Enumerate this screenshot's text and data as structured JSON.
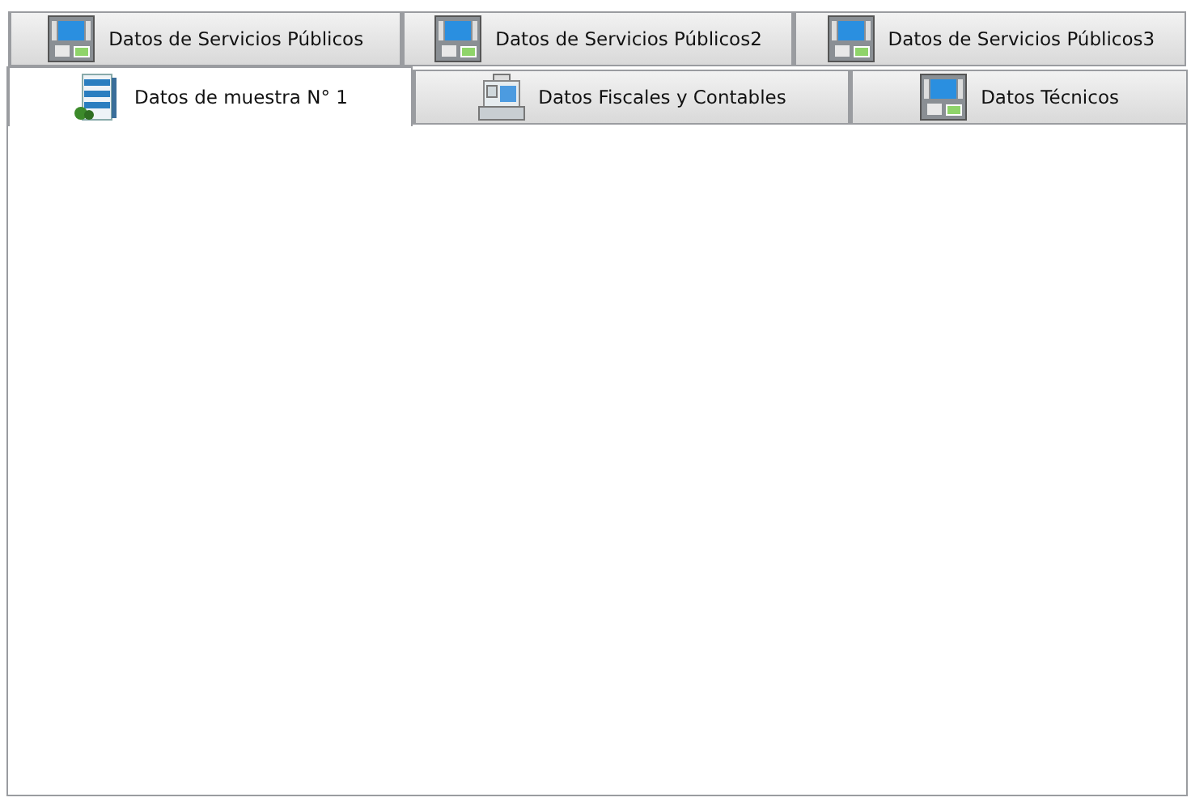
{
  "tab_rows": [
    {
      "tabs": [
        {
          "label": "Datos de Servicios Públicos",
          "kind": "atm",
          "selected": false
        },
        {
          "label": "Datos de Servicios Públicos2",
          "kind": "atm",
          "selected": false
        },
        {
          "label": "Datos de Servicios Públicos3",
          "kind": "atm",
          "selected": false
        }
      ]
    },
    {
      "tabs": [
        {
          "label": "Datos de muestra N° 1",
          "kind": "building",
          "selected": true
        },
        {
          "label": "Datos Fiscales y Contables",
          "kind": "register",
          "selected": false
        },
        {
          "label": "Datos Técnicos",
          "kind": "atm",
          "selected": false
        }
      ]
    }
  ]
}
